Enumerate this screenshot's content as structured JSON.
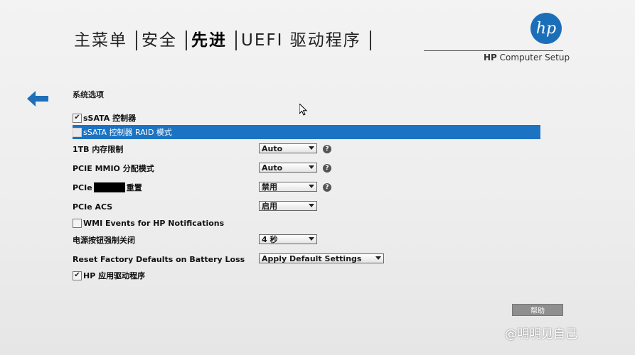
{
  "menu": {
    "tabs": [
      "主菜单",
      "安全",
      "先进",
      "UEFI 驱动程序"
    ],
    "active_index": 2
  },
  "header": {
    "logo_text": "hp",
    "product": "HP Computer Setup"
  },
  "section": {
    "title": "系统选项"
  },
  "options": {
    "ssata": {
      "label": "sSATA 控制器",
      "checked": true
    },
    "ssata_raid": {
      "label": "sSATA 控制器 RAID 模式",
      "checked": false,
      "selected": true
    },
    "mem_limit": {
      "label": "1TB 内存限制",
      "value": "Auto"
    },
    "pcie_mmio": {
      "label": "PCIE MMIO 分配模式",
      "value": "Auto"
    },
    "pcie_reset": {
      "label_prefix": "PCIe",
      "label_suffix": "重置",
      "value": "禁用"
    },
    "pcie_acs": {
      "label": "PCIe ACS",
      "value": "启用"
    },
    "wmi": {
      "label": "WMI Events for HP Notifications",
      "checked": false
    },
    "power_button": {
      "label": "电源按钮强制关闭",
      "value": "4 秒"
    },
    "reset_defaults": {
      "label": "Reset Factory Defaults on Battery Loss",
      "value": "Apply Default Settings"
    },
    "hp_app_driver": {
      "label": "HP 应用驱动程序",
      "checked": true
    }
  },
  "help_mark": "?",
  "check_mark": "✔",
  "help_button": {
    "label": "帮助"
  },
  "watermark": "@明明见自己",
  "colors": {
    "highlight": "#1c73c2",
    "logo": "#1b6fb9"
  }
}
